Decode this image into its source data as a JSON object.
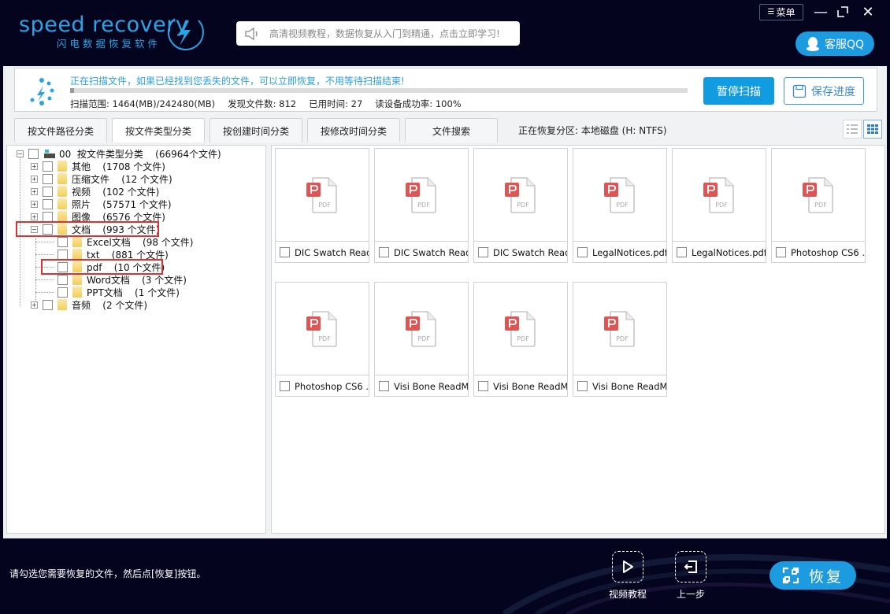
{
  "app": {
    "logo_en": "speed recovery",
    "logo_cn": "闪电数据恢复软件",
    "notice": "高清视频教程，数据恢复从入门到精通，点击立即学习!",
    "menu_label": "菜单",
    "qq_label": "客服QQ",
    "colors": {
      "accent": "#1c9be0",
      "bg_dark": "#05041e",
      "highlight": "#e03030"
    }
  },
  "scan": {
    "message": "正在扫描文件，如果已经找到您丢失的文件，可以立即恢复，不用等待扫描结束!",
    "progress_percent": 0.6,
    "stats": [
      "扫描范围: 1464(MB)/242480(MB)",
      "发现文件数: 812",
      "已用时间: 27",
      "读设备成功率: 100%"
    ],
    "pause_label": "暂停扫描",
    "save_label": "保存进度"
  },
  "tabs": [
    {
      "label": "按文件路径分类"
    },
    {
      "label": "按文件类型分类"
    },
    {
      "label": "按创建时间分类"
    },
    {
      "label": "按修改时间分类"
    },
    {
      "label": "文件搜索"
    }
  ],
  "partition": "正在恢复分区: 本地磁盘 (H: NTFS)",
  "tree": {
    "root": {
      "label": "00  按文件类型分类    (66964个文件)"
    },
    "items": [
      {
        "label": "其他    (1708 个文件)"
      },
      {
        "label": "压缩文件    (12 个文件)"
      },
      {
        "label": "视频    (102 个文件)"
      },
      {
        "label": "照片    (57571 个文件)"
      },
      {
        "label": "图像    (6576 个文件)"
      },
      {
        "label": "文档    (993 个文件)"
      },
      {
        "label": "Excel文档    (98 个文件)"
      },
      {
        "label": "txt    (881 个文件)"
      },
      {
        "label": "pdf    (10 个文件)"
      },
      {
        "label": "Word文档    (3 个文件)"
      },
      {
        "label": "PPT文档    (1 个文件)"
      },
      {
        "label": "音频    (2 个文件)"
      }
    ]
  },
  "files": [
    {
      "name": "DIC Swatch Read..."
    },
    {
      "name": "DIC Swatch Read..."
    },
    {
      "name": "DIC Swatch Read..."
    },
    {
      "name": "LegalNotices.pdf"
    },
    {
      "name": "LegalNotices.pdf"
    },
    {
      "name": "Photoshop CS6 ..."
    },
    {
      "name": "Photoshop CS6 ..."
    },
    {
      "name": "Visi Bone ReadMe..."
    },
    {
      "name": "Visi Bone ReadMe..."
    },
    {
      "name": "Visi Bone ReadMe..."
    }
  ],
  "pdf_icon_text": "PDF",
  "footer": {
    "hint": "请勾选您需要恢复的文件，然后点[恢复]按钮。",
    "video_label": "视频教程",
    "back_label": "上一步",
    "recover_label": "恢复"
  }
}
